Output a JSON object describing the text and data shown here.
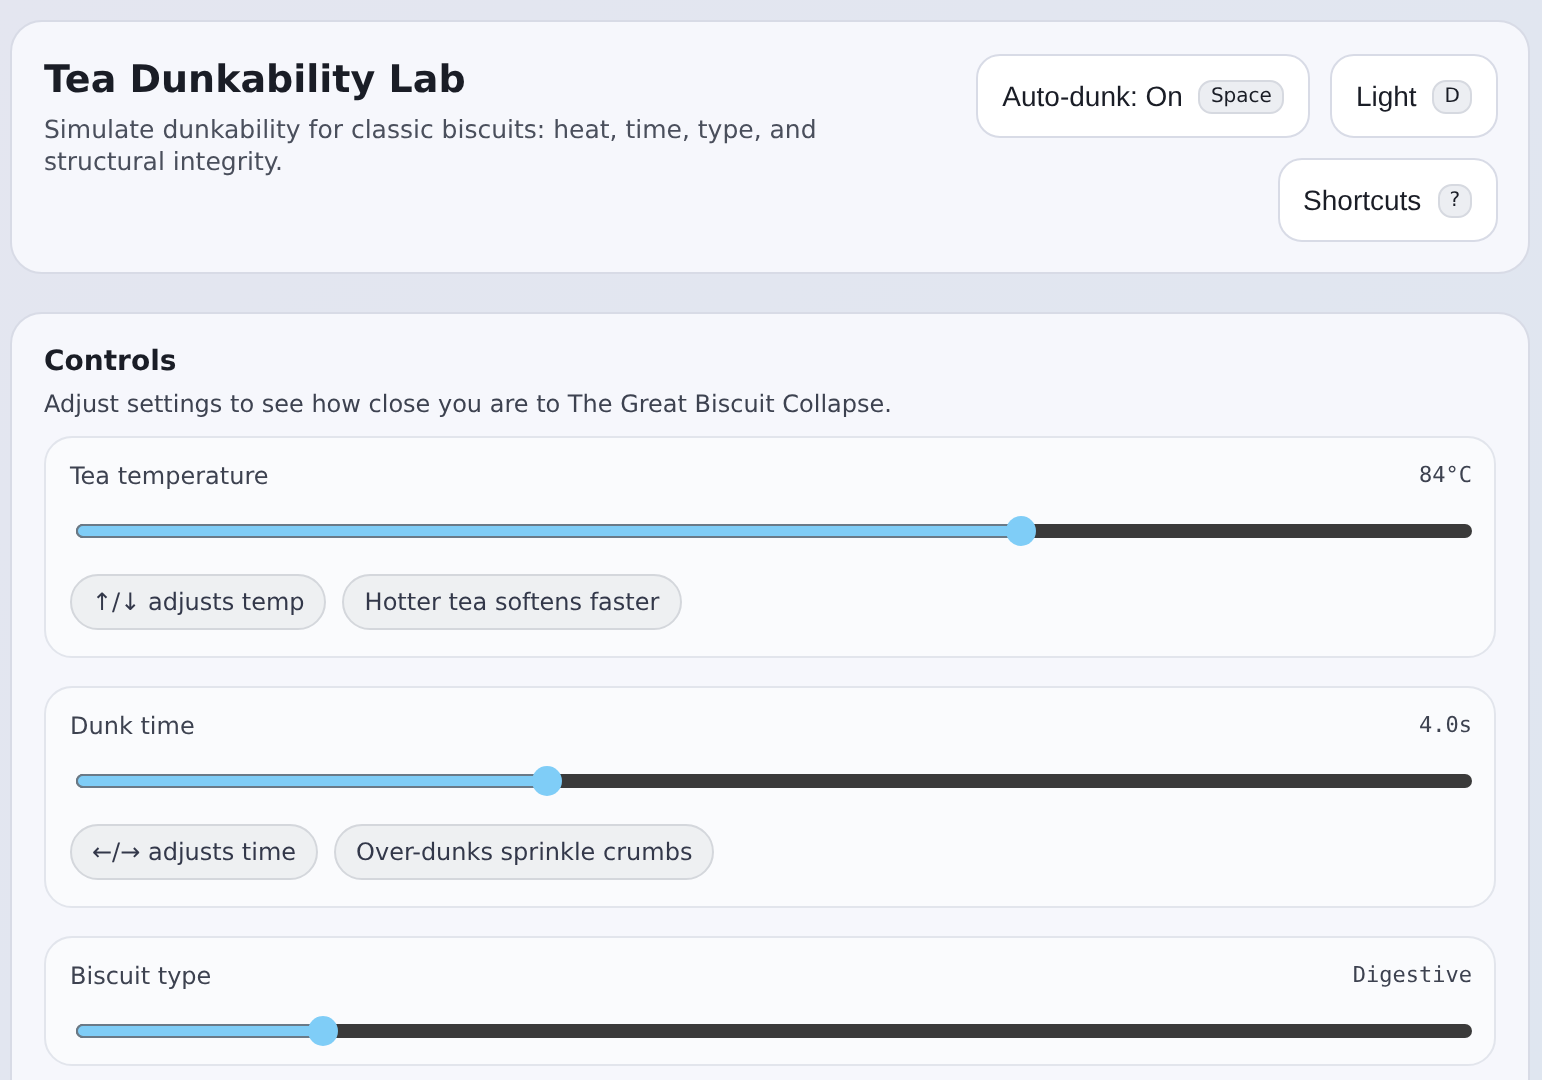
{
  "header": {
    "title": "Tea Dunkability Lab",
    "subtitle": "Simulate dunkability for classic biscuits: heat, time, type, and structural integrity.",
    "buttons": [
      {
        "label": "Auto-dunk: On",
        "key": "Space"
      },
      {
        "label": "Light",
        "key": "D"
      },
      {
        "label": "Shortcuts",
        "key": "?"
      }
    ]
  },
  "controls": {
    "title": "Controls",
    "subtitle": "Adjust settings to see how close you are to The Great Biscuit Collapse.",
    "items": [
      {
        "label": "Tea temperature",
        "reading": "84°C",
        "level": 0.676,
        "chips": [
          "↑/↓ adjusts temp",
          "Hotter tea softens faster"
        ]
      },
      {
        "label": "Dunk time",
        "reading": "4.0s",
        "level": 0.337,
        "chips": [
          "←/→ adjusts time",
          "Over-dunks sprinkle crumbs"
        ]
      },
      {
        "label": "Biscuit type",
        "reading": "Digestive",
        "level": 0.176
      }
    ]
  }
}
